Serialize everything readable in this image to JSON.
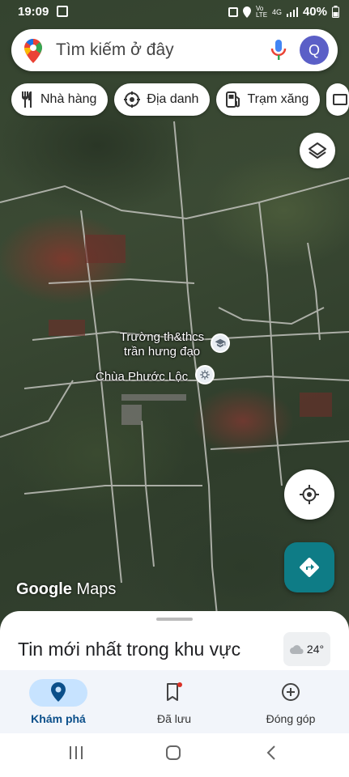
{
  "status_bar": {
    "time": "19:09",
    "network_badge": "Vo LTE",
    "signal_badge": "4G",
    "battery": "40%"
  },
  "search": {
    "placeholder": "Tìm kiếm ở đây",
    "avatar_letter": "Q"
  },
  "chips": [
    {
      "label": "Nhà hàng",
      "icon": "fork-knife-icon"
    },
    {
      "label": "Địa danh",
      "icon": "landmark-icon"
    },
    {
      "label": "Trạm xăng",
      "icon": "gas-station-icon"
    }
  ],
  "map": {
    "poi_school": "Trường th&thcs trần hưng đạo",
    "poi_temple": "Chùa Phước Lộc",
    "watermark_google": "Google",
    "watermark_maps": "Maps"
  },
  "sheet": {
    "title": "Tin mới nhất trong khu vực",
    "weather": "24°"
  },
  "bottom_nav": {
    "explore": "Khám phá",
    "saved": "Đã lưu",
    "contribute": "Đóng góp"
  },
  "colors": {
    "accent": "#0e7c86",
    "active_pill": "#c7e3ff",
    "avatar": "#5b5fc7"
  }
}
